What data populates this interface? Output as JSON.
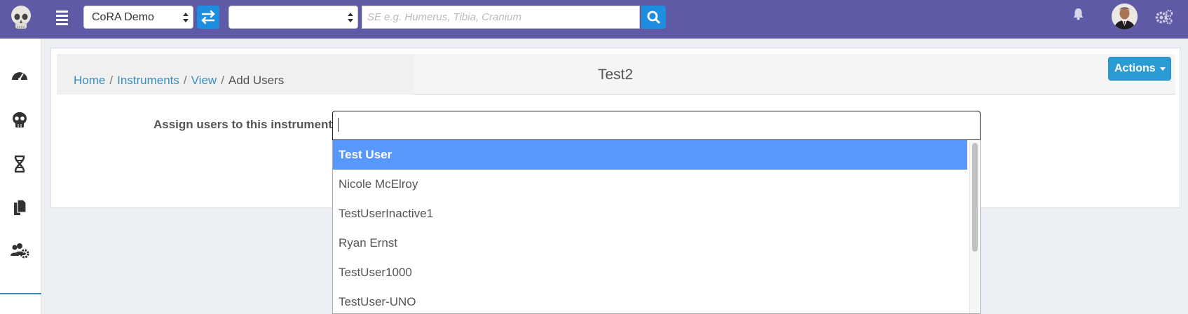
{
  "topbar": {
    "site_select_value": "CoRA Demo",
    "project_select_value": "",
    "search_placeholder": "SE e.g. Humerus, Tibia, Cranium",
    "colors": {
      "bar": "#5f5aa6",
      "accent": "#1e8ee0"
    },
    "icons": [
      "skull-logo-icon",
      "hamburger-menu-icon",
      "switch-arrows-icon",
      "search-icon",
      "bell-icon",
      "user-avatar",
      "gears-icon"
    ]
  },
  "sidebar": {
    "items": [
      {
        "icon": "dashboard-gauge-icon"
      },
      {
        "icon": "skull-icon"
      },
      {
        "icon": "dna-icon"
      },
      {
        "icon": "documents-icon"
      },
      {
        "icon": "user-gear-icon"
      }
    ]
  },
  "breadcrumb": {
    "home": "Home",
    "instruments": "Instruments",
    "view": "View",
    "current": "Add Users",
    "separator": "/"
  },
  "page": {
    "title": "Test2",
    "actions_label": "Actions",
    "form_label": "Assign users to this instrument",
    "assign_input_value": ""
  },
  "dropdown": {
    "options": [
      "Test User",
      "Nicole McElroy",
      "TestUserInactive1",
      "Ryan Ernst",
      "TestUser1000",
      "TestUser-UNO"
    ],
    "highlighted_color": "#5897fb"
  }
}
